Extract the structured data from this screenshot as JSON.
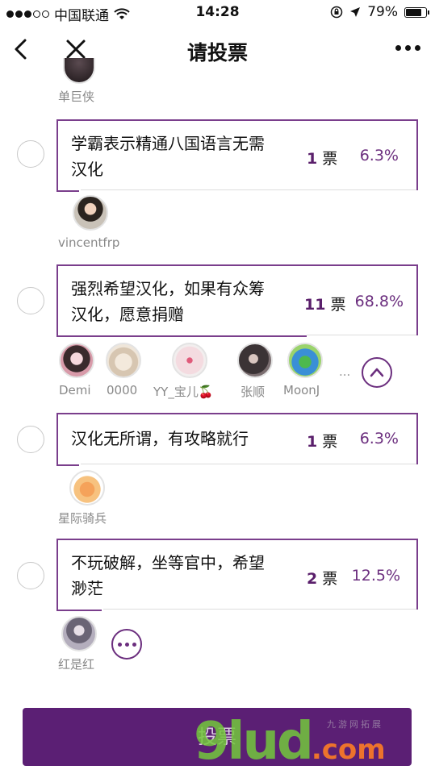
{
  "status_bar": {
    "carrier": "中国联通",
    "time": "14:28",
    "battery": "79%"
  },
  "nav": {
    "title": "请投票"
  },
  "top_voter": {
    "name": "单巨侠"
  },
  "options": [
    {
      "text_line1": "学霸表示精通八国语言无需",
      "text_line2": "汉化",
      "count": "1",
      "unit": "票",
      "percent": "6.3%",
      "fraction": 0.063,
      "voters": [
        {
          "name": "vincentfrp"
        }
      ]
    },
    {
      "text_line1": "强烈希望汉化，如果有众筹",
      "text_line2": "汉化，愿意捐赠",
      "count": "11",
      "unit": "票",
      "percent": "68.8%",
      "fraction": 0.688,
      "voters": [
        {
          "name": "Demi"
        },
        {
          "name": "0000"
        },
        {
          "name": "YY_宝儿🍒"
        },
        {
          "name": "张顺"
        },
        {
          "name": "MoonJ"
        }
      ],
      "more": "..."
    },
    {
      "text_line1": "汉化无所谓，有攻略就行",
      "text_line2": "",
      "count": "1",
      "unit": "票",
      "percent": "6.3%",
      "fraction": 0.063,
      "voters": [
        {
          "name": "星际骑兵"
        }
      ]
    },
    {
      "text_line1": "不玩破解，坐等官中，希望",
      "text_line2": "渺茫",
      "count": "2",
      "unit": "票",
      "percent": "12.5%",
      "fraction": 0.125,
      "voters": [
        {
          "name": "红是红"
        }
      ]
    }
  ],
  "vote_button": {
    "label": "投票"
  },
  "watermark": {
    "brand": "9lud",
    "domain": ".com",
    "cn": "九游网拓展"
  },
  "colors": {
    "accent": "#6b2e7e",
    "button": "#5b1f74"
  }
}
